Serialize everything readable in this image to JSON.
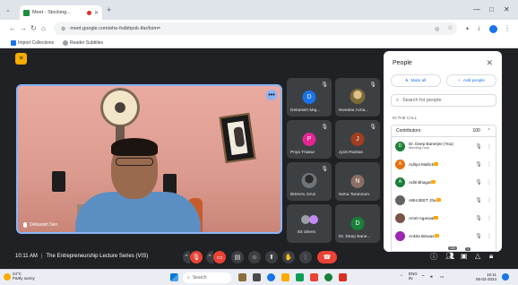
{
  "browser": {
    "tab_title": "Meet - Stocking...",
    "url": "meet.google.com/ehe-fvdkhpxk-ifar/loim=",
    "bookmarks": [
      "Import Collections",
      "Reader Subtitles"
    ],
    "window_controls": [
      "—",
      "□",
      "✕"
    ]
  },
  "meet": {
    "main_speaker": "Debasish Sen",
    "tiles": [
      {
        "name": "Debasish Maj...",
        "initial": "D",
        "color": "#1a73e8"
      },
      {
        "name": "Nivedita Acha...",
        "initial": "",
        "color": "#c5a55a"
      },
      {
        "name": "Priya Thakur",
        "initial": "P",
        "color": "#e52592"
      },
      {
        "name": "Jyoti RuiDas",
        "initial": "J",
        "color": "#a03f1f"
      },
      {
        "name": "BISHAL DAS",
        "initial": "",
        "color": "#6f7479"
      },
      {
        "name": "Neha Tarannum",
        "initial": "N",
        "color": "#8d6e63"
      },
      {
        "name": "83 others",
        "initial": "",
        "color": "#5f6368"
      },
      {
        "name": "Dr. Deep Bane...",
        "initial": "D",
        "color": "#188038"
      }
    ],
    "meeting_time": "10:11 AM",
    "meeting_title": "The Entrepreneurship Lecture Series (VIS)",
    "people_count_badge": "100",
    "reactions_badge": "1"
  },
  "people_panel": {
    "title": "People",
    "mute_all": "Mute all",
    "add_people": "Add people",
    "search_placeholder": "Search for people",
    "in_call_label": "IN THE CALL",
    "contributors_label": "Contributors",
    "contributors_count": "100",
    "people": [
      {
        "name": "Dr. Deep Banerjee (You)",
        "sub": "Meeting host",
        "initial": "D",
        "color": "#188038"
      },
      {
        "name": "Aditya Mallick",
        "sub": "",
        "initial": "A",
        "color": "#e8710a"
      },
      {
        "name": "Aditi Bhagat",
        "sub": "",
        "initial": "A",
        "color": "#188038"
      },
      {
        "name": "ABHIJEET Jha",
        "sub": "",
        "initial": "",
        "color": "#5f6368"
      },
      {
        "name": "Amrit Agarwal",
        "sub": "",
        "initial": "",
        "color": "#795548"
      },
      {
        "name": "Ankita Biswas",
        "sub": "",
        "initial": "",
        "color": "#9c27b0"
      }
    ]
  },
  "taskbar": {
    "weather_temp": "24°C",
    "weather_desc": "Partly sunny",
    "search_label": "Search",
    "clock_time": "10:11",
    "clock_date": "06-02-2024",
    "lang": "ENG\nIN"
  }
}
